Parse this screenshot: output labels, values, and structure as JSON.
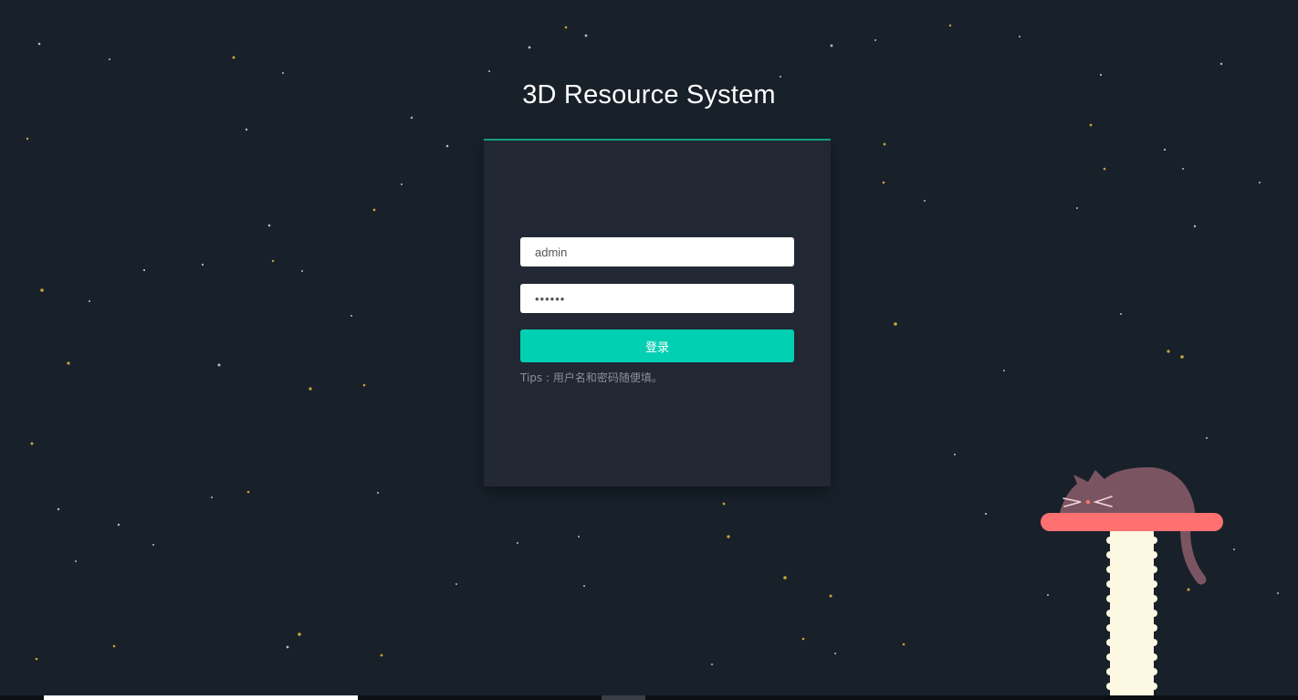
{
  "title": "3D Resource System",
  "login_form": {
    "username_value": "admin",
    "password_value": "••••••",
    "submit_label": "登录",
    "tips": "Tips : 用户名和密码随便填。"
  },
  "colors": {
    "background": "#18202a",
    "card": "#222833",
    "accent": "#03cfb3",
    "card_border": "#119d82",
    "cat_body": "#7a5561",
    "cat_shelf": "#ff7070",
    "cat_post": "#fdf8e2"
  },
  "icons": {
    "mascot": "sleeping-cat-illustration"
  }
}
